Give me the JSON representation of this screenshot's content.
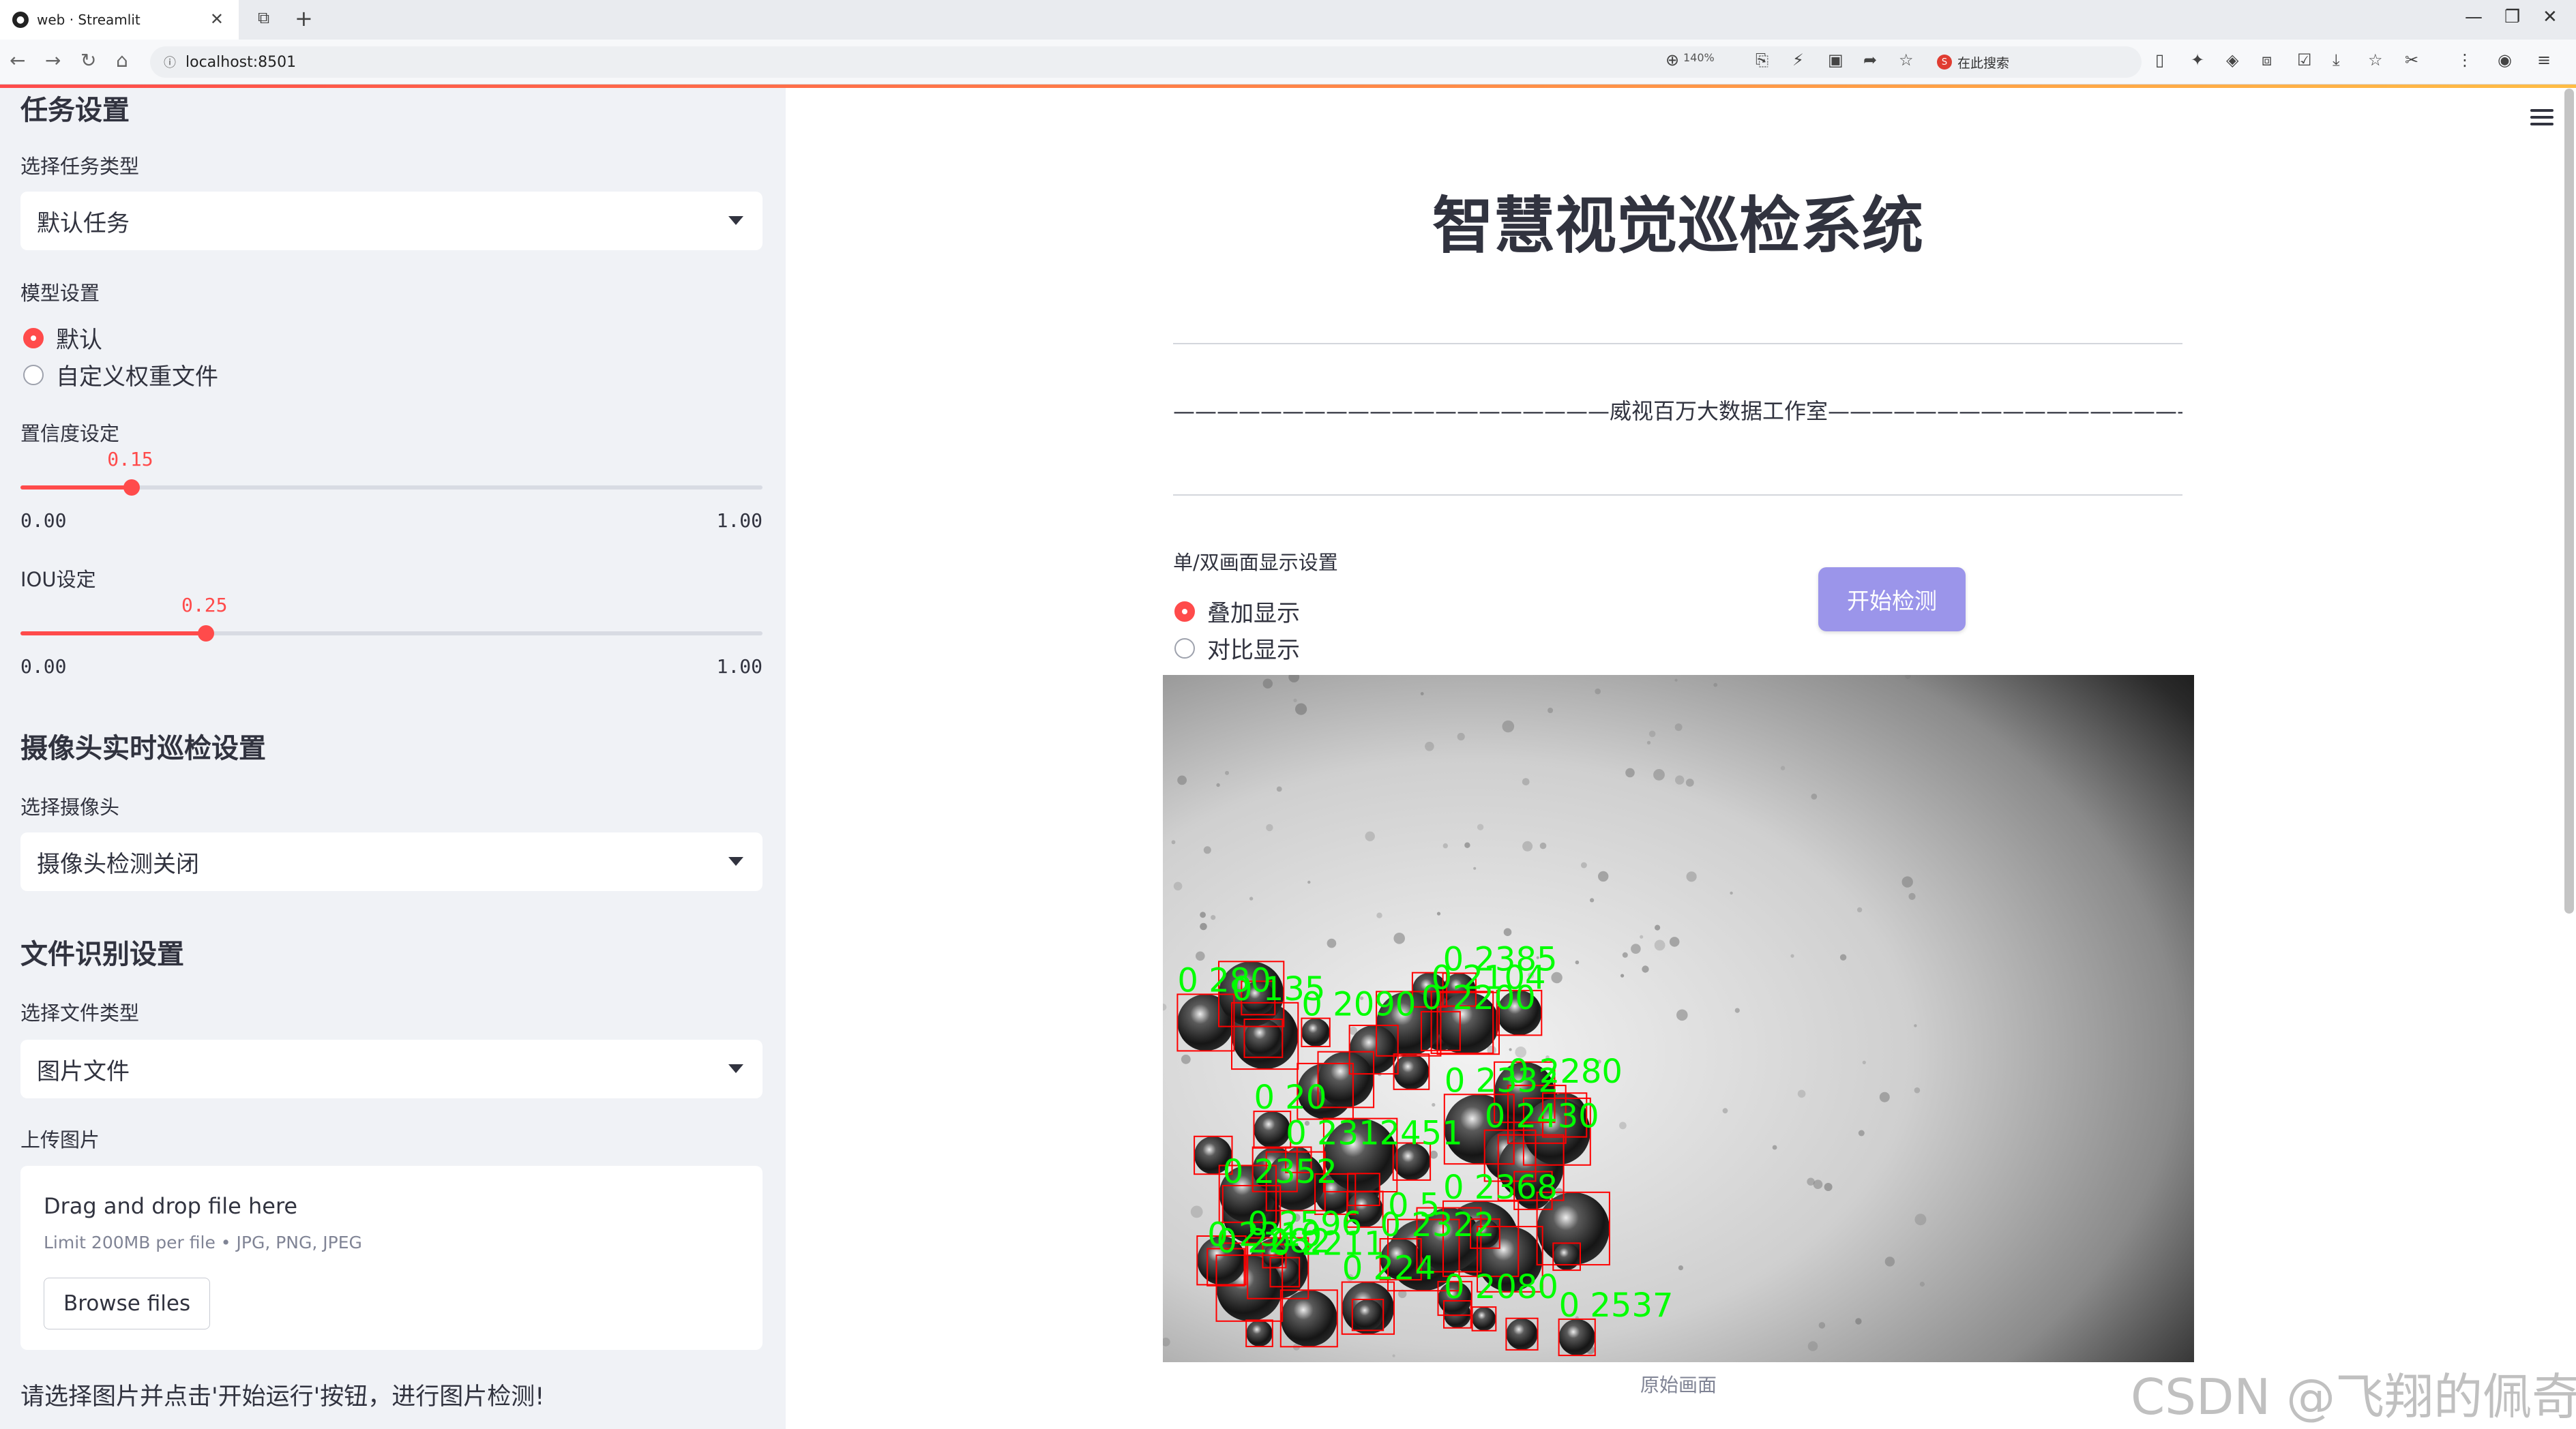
{
  "browser": {
    "tab_title": "web · Streamlit",
    "url": "localhost:8501",
    "zoom": "140%",
    "search_placeholder": "在此搜索"
  },
  "sidebar": {
    "task_section": "任务设置",
    "task_type_label": "选择任务类型",
    "task_type_value": "默认任务",
    "model_label": "模型设置",
    "model_options": [
      "默认",
      "自定义权重文件"
    ],
    "model_selected": 0,
    "conf_label": "置信度设定",
    "conf_value": "0.15",
    "conf_fraction": 0.15,
    "iou_label": "IOU设定",
    "iou_value": "0.25",
    "iou_fraction": 0.25,
    "slider_min": "0.00",
    "slider_max": "1.00",
    "camera_section": "摄像头实时巡检设置",
    "camera_label": "选择摄像头",
    "camera_value": "摄像头检测关闭",
    "file_section": "文件识别设置",
    "file_type_label": "选择文件类型",
    "file_type_value": "图片文件",
    "upload_label": "上传图片",
    "upload_title": "Drag and drop file here",
    "upload_limit": "Limit 200MB per file • JPG, PNG, JPEG",
    "browse_label": "Browse files",
    "hint": "请选择图片并点击'开始运行'按钮，进行图片检测!"
  },
  "main": {
    "title": "智慧视觉巡检系统",
    "dash_line": "————————————————————威视百万大数据工作室—————————————————————",
    "display_label": "单/双画面显示设置",
    "display_options": [
      "叠加显示",
      "对比显示"
    ],
    "display_selected": 0,
    "start_button": "开始检测",
    "image_caption": "原始画面",
    "detection_labels": [
      "0 2312451",
      "0 2352",
      "0 2596",
      "0 2280",
      "0 5",
      "0 2332",
      "0 2368",
      "0 280",
      "0 2537",
      "0 2310",
      "0 2080",
      "0 2211",
      "0 2282",
      "0 2430",
      "0 2104",
      "0 135",
      "0 2385",
      "0 2200",
      "0 224",
      "0 2322",
      "0 2090",
      "0 20"
    ],
    "box_color": "#ff0000",
    "label_color": "#00ff00"
  },
  "watermark": "CSDN @飞翔的佩奇",
  "colors": {
    "accent": "#ff4b4b",
    "button": "#9b95ea",
    "sidebar_bg": "#f0f2f6"
  }
}
